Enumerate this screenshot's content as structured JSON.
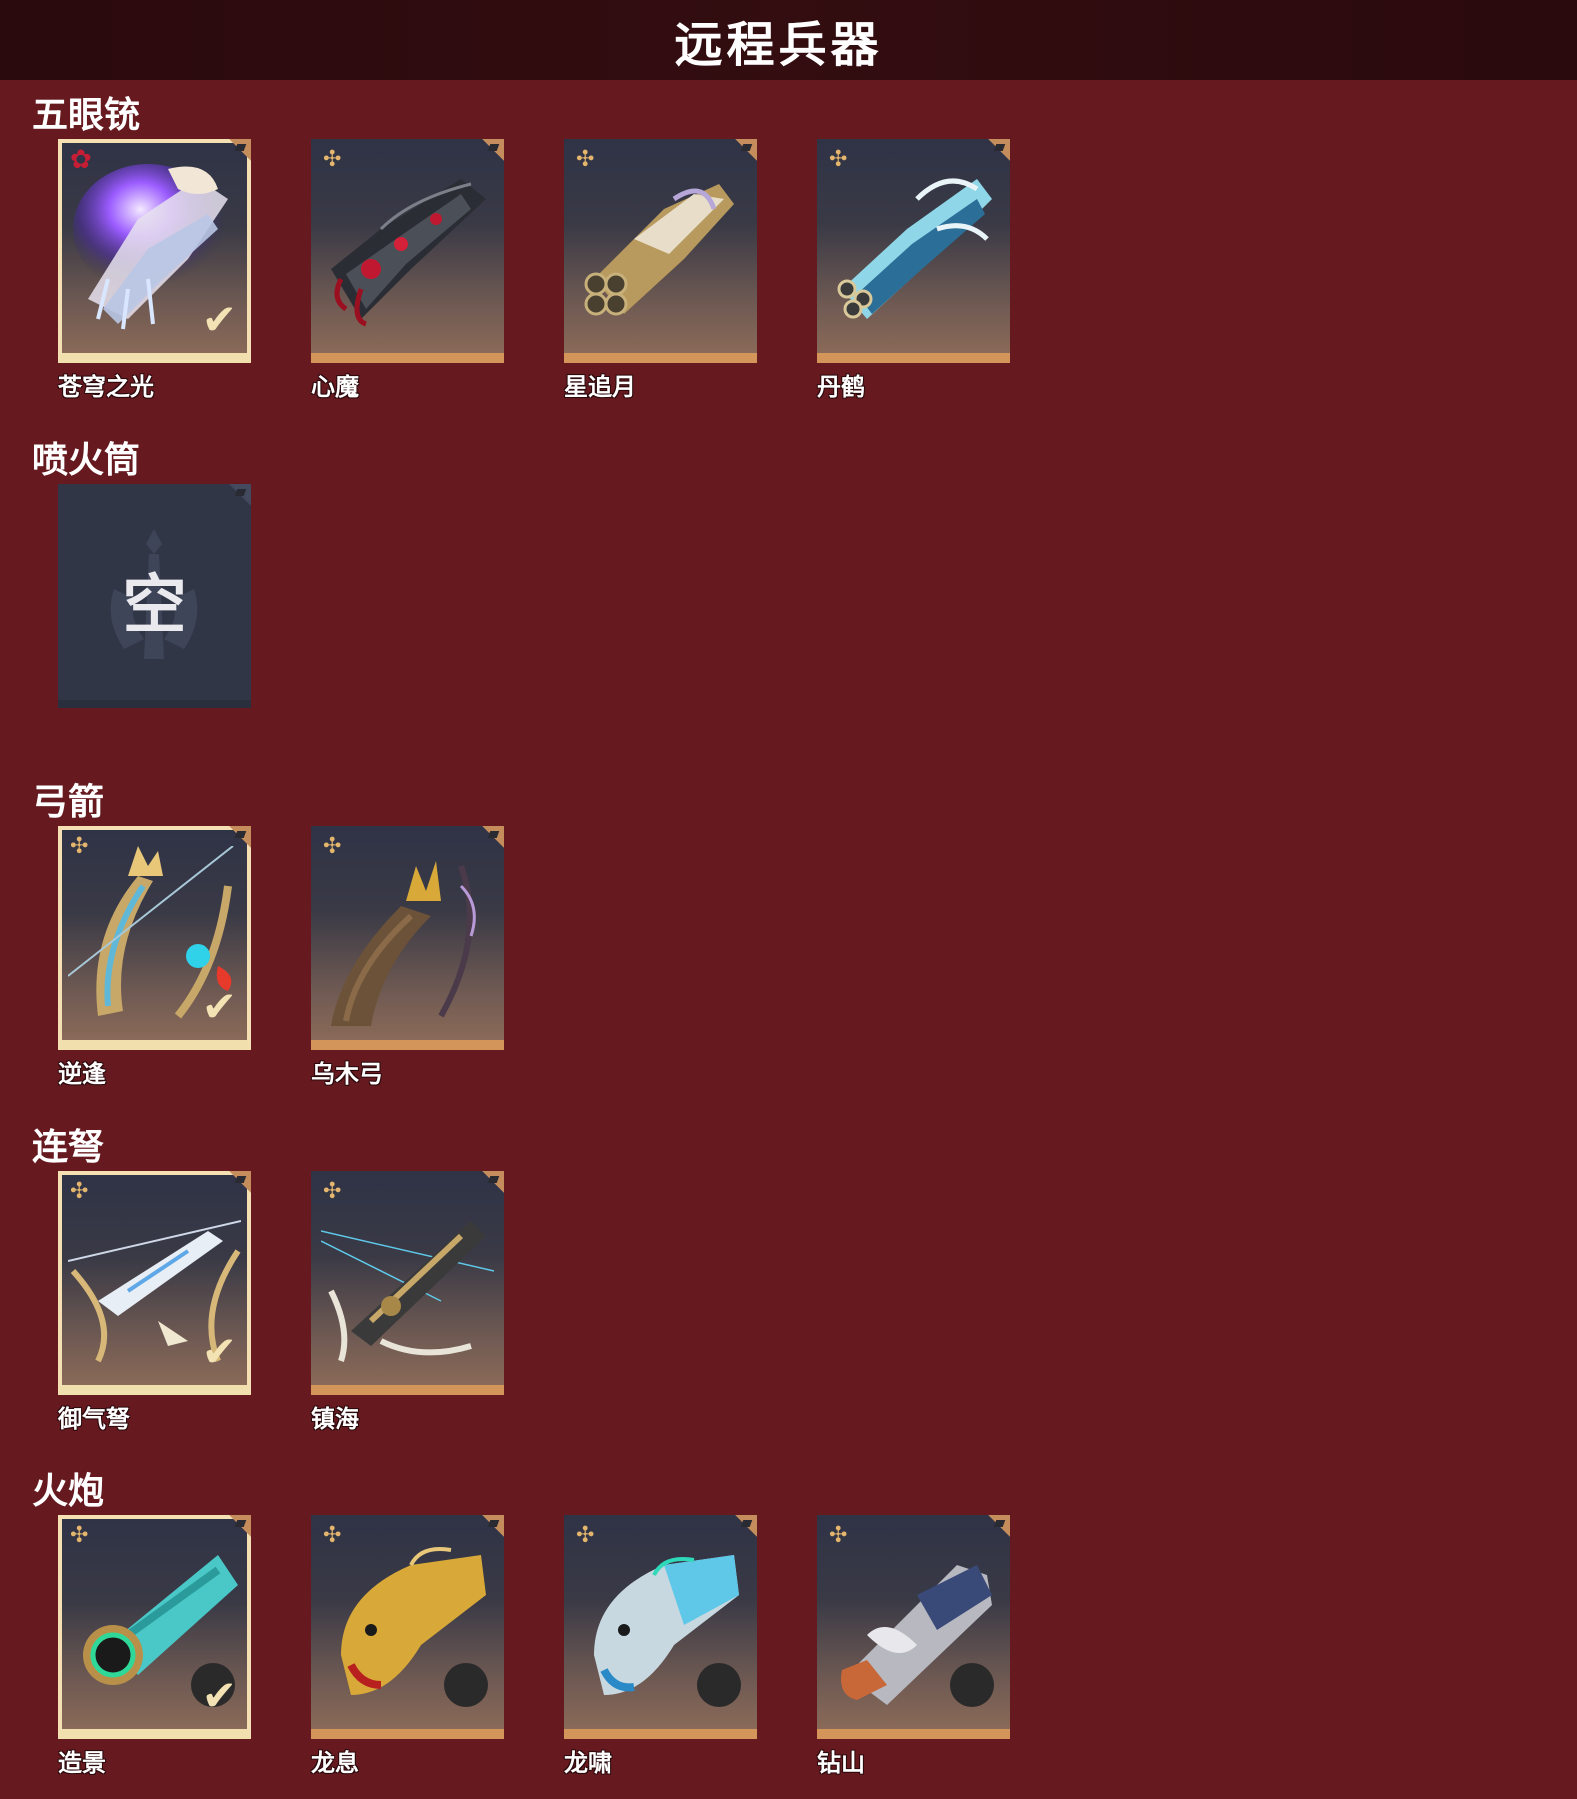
{
  "header": {
    "title": "远程兵器"
  },
  "colors": {
    "background": "#661a1f",
    "header": "#2a0a0d",
    "card_accent": "#d4955a",
    "equipped_border": "#f4e0b3",
    "rank_gold": "#e3b56d",
    "rank_red": "#c81e35"
  },
  "sections": [
    {
      "title": "五眼铳",
      "items": [
        {
          "name": "苍穹之光",
          "equipped": true,
          "rank_icon": "red-star-icon"
        },
        {
          "name": "心魔",
          "equipped": false,
          "rank_icon": "gold-shuriken-icon"
        },
        {
          "name": "星追月",
          "equipped": false,
          "rank_icon": "gold-shuriken-icon"
        },
        {
          "name": "丹鹤",
          "equipped": false,
          "rank_icon": "gold-shuriken-icon"
        }
      ]
    },
    {
      "title": "喷火筒",
      "items": [
        {
          "name": "",
          "empty": true,
          "empty_label": "空"
        }
      ]
    },
    {
      "title": "弓箭",
      "items": [
        {
          "name": "逆逢",
          "equipped": true,
          "rank_icon": "gold-shuriken-icon"
        },
        {
          "name": "乌木弓",
          "equipped": false,
          "rank_icon": "gold-shuriken-icon"
        }
      ]
    },
    {
      "title": "连弩",
      "items": [
        {
          "name": "御气弩",
          "equipped": true,
          "rank_icon": "gold-shuriken-icon"
        },
        {
          "name": "镇海",
          "equipped": false,
          "rank_icon": "gold-shuriken-icon"
        }
      ]
    },
    {
      "title": "火炮",
      "items": [
        {
          "name": "造景",
          "equipped": true,
          "rank_icon": "gold-shuriken-icon"
        },
        {
          "name": "龙息",
          "equipped": false,
          "rank_icon": "gold-shuriken-icon"
        },
        {
          "name": "龙啸",
          "equipped": false,
          "rank_icon": "gold-shuriken-icon"
        },
        {
          "name": "钻山",
          "equipped": false,
          "rank_icon": "gold-shuriken-icon"
        }
      ]
    }
  ]
}
